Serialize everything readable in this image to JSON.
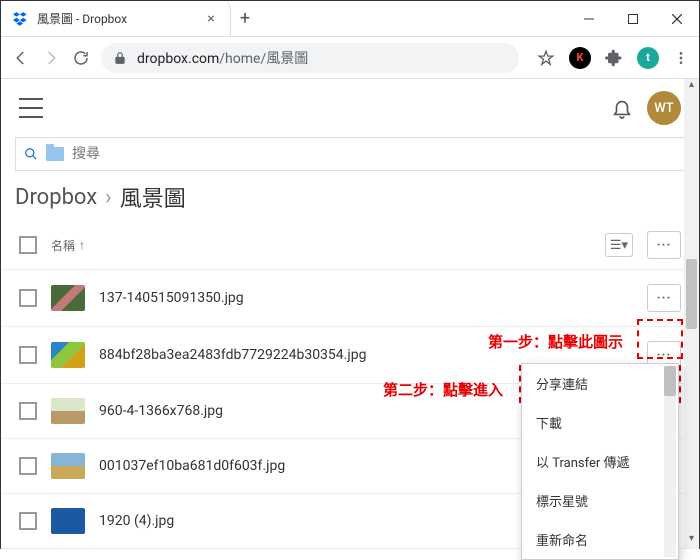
{
  "browser": {
    "tab_title": "風景圖 - Dropbox",
    "url_host": "dropbox.com",
    "url_path": "/home/風景圖"
  },
  "header": {
    "avatar_initials": "WT"
  },
  "search": {
    "placeholder": "搜尋"
  },
  "breadcrumb": {
    "root": "Dropbox",
    "current": "風景圖"
  },
  "list": {
    "sort_label": "名稱",
    "files": [
      {
        "name": "137-140515091350.jpg"
      },
      {
        "name": "884bf28ba3ea2483fdb7729224b30354.jpg"
      },
      {
        "name": "960-4-1366x768.jpg"
      },
      {
        "name": "001037ef10ba681d0f603f.jpg"
      },
      {
        "name": "1920 (4).jpg"
      }
    ]
  },
  "context_menu": {
    "items": [
      "分享連結",
      "下載",
      "以 Transfer 傳遞",
      "標示星號",
      "重新命名"
    ]
  },
  "annotations": {
    "step1": "第一步：點擊此圖示",
    "step2": "第二步：點擊進入"
  }
}
